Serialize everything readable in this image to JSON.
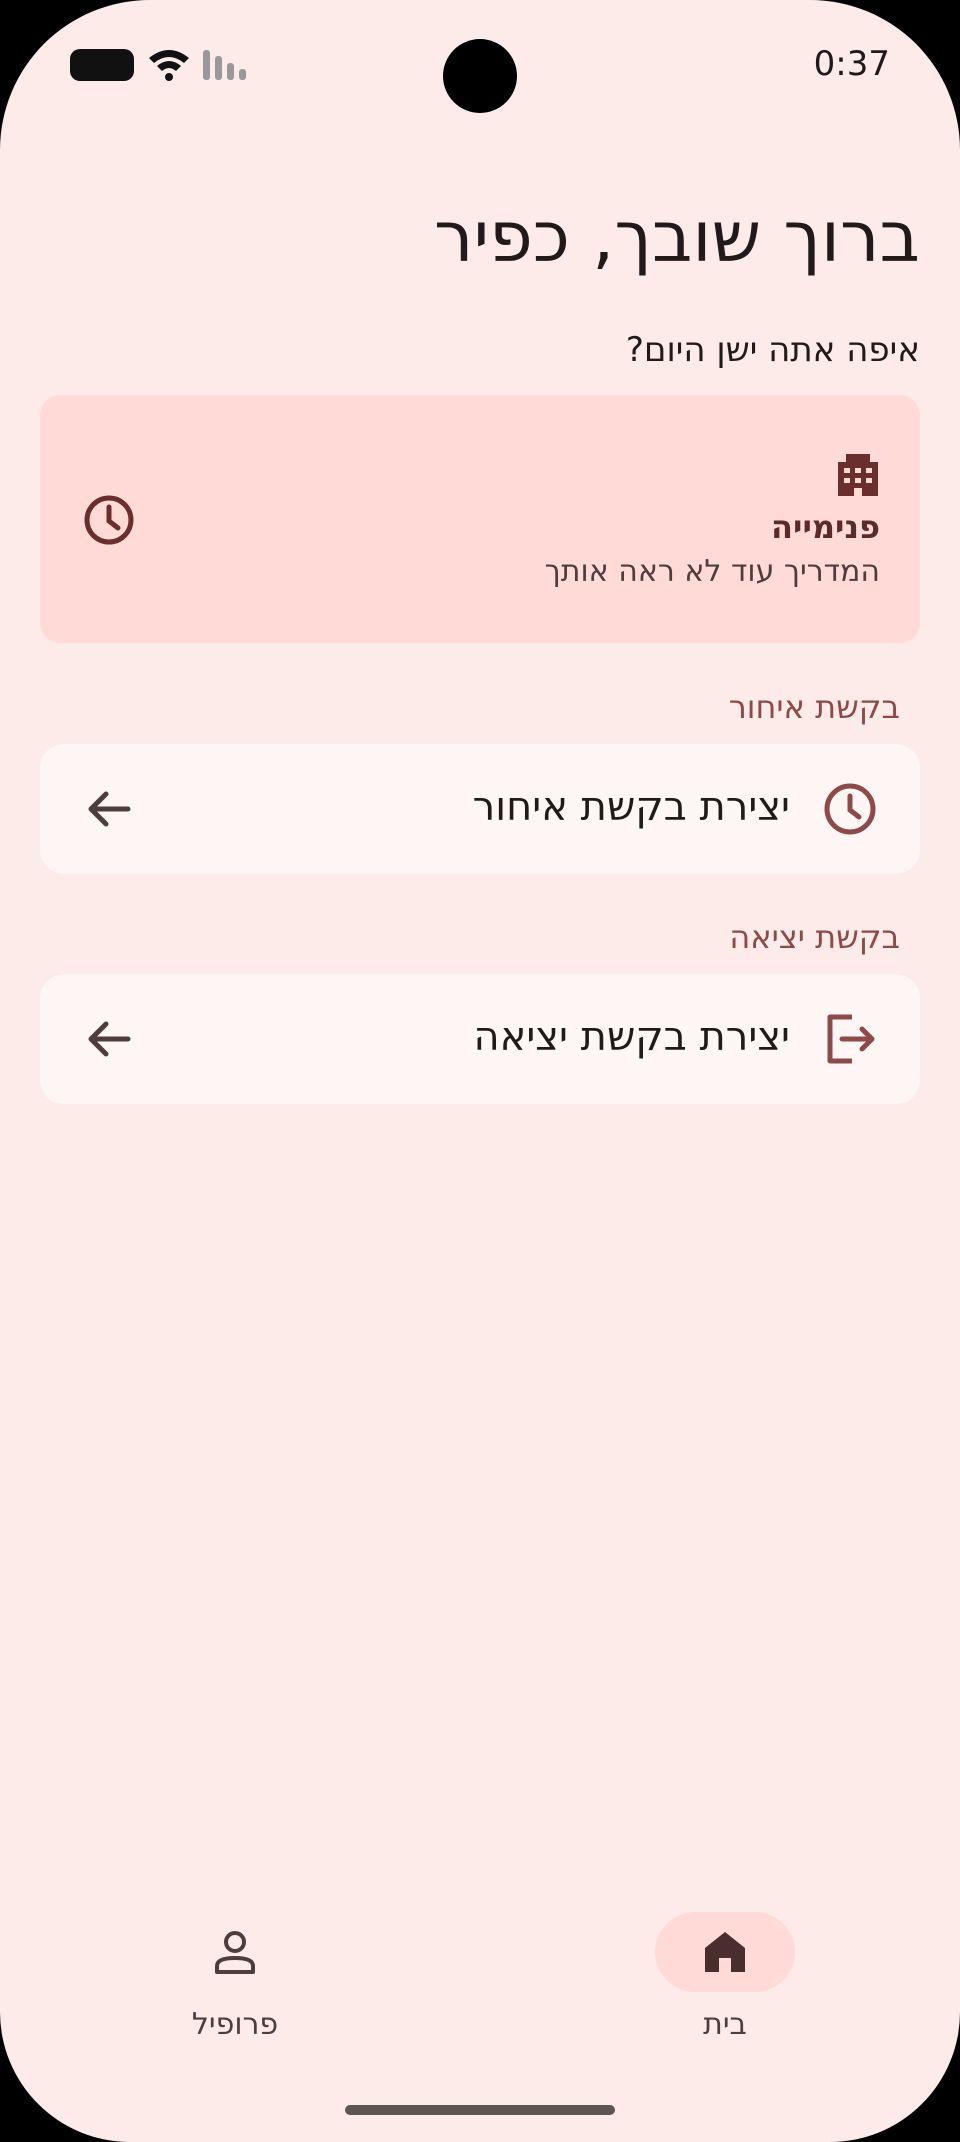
{
  "status_bar": {
    "time": "0:37"
  },
  "header": {
    "greeting": "ברוך שובך, כפיר",
    "question": "איפה אתה ישן היום?"
  },
  "location_card": {
    "icon": "building-icon",
    "title": "פנימייה",
    "subtitle": "המדריך עוד לא ראה אותך",
    "status_icon": "clock-icon"
  },
  "delay_section": {
    "label": "בקשת איחור",
    "action_label": "יצירת בקשת איחור",
    "icon": "clock-icon"
  },
  "exit_section": {
    "label": "בקשת יציאה",
    "action_label": "יצירת בקשת יציאה",
    "icon": "logout-icon"
  },
  "bottom_nav": {
    "items": [
      {
        "label": "בית",
        "icon": "home-icon",
        "selected": true
      },
      {
        "label": "פרופיל",
        "icon": "person-icon",
        "selected": false
      }
    ]
  },
  "colors": {
    "background": "#fcebe9",
    "card_highlight": "#ffdad6",
    "card": "#fdf6f5",
    "accent": "#8d4a48",
    "icon_dark": "#6b2e2e"
  }
}
